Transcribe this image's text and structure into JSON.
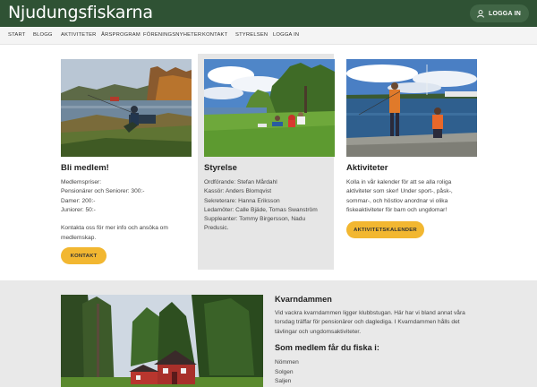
{
  "header": {
    "site_title": "Njudungsfiskarna",
    "login_label": "LOGGA IN"
  },
  "nav": {
    "items": [
      "START",
      "BLOGG",
      "AKTIVITETER",
      "ÅRSPROGRAM",
      "FÖRENINGSNYHETER",
      "KONTAKT",
      "STYRELSEN",
      "LOGGA IN"
    ]
  },
  "cards": [
    {
      "title": "Bli medlem!",
      "lines": [
        "Medlemspriser:",
        "Pensionärer och Seniorer: 300:-",
        "Damer: 200:-",
        "Juniorer: 50:-",
        "",
        "Kontakta oss för mer info och ansöka om",
        "medlemskap."
      ],
      "button": "KONTAKT"
    },
    {
      "title": "Styrelse",
      "lines": [
        "Ordförande: Stefan Mårdahl",
        "Kassör: Anders Blomqvist",
        "Sekreterare: Hanna Eriksson",
        "Ledamöter: Calle Bjäde, Tomas Swanström",
        "Suppleanter: Tommy Birgersson, Nadu",
        "Predusic."
      ]
    },
    {
      "title": "Aktiviteter",
      "lines": [
        "Kolla in vår kalender för att se alla roliga",
        "aktiviteter som sker! Under sport-, påsk-,",
        "sommar-, och höstlov anordnar vi olika",
        "fiskeaktiviteter för barn och ungdomar!"
      ],
      "button": "AKTIVITETSKALENDER"
    }
  ],
  "kvarndammen": {
    "title": "Kvarndammen",
    "lines": [
      "Vid vackra kvarndammen ligger klubbstugan. Här har vi bland annat våra",
      "torsdag träffar för pensionärer och dagledigа. I Kvarndammen hålls det",
      "tävlingar och ungdomsaktiviteter."
    ],
    "subtitle": "Som medlem får du fiska i:",
    "waters": [
      "Nömmen",
      "Solgen",
      "Saljen"
    ]
  },
  "colors": {
    "header_bg": "#2f5234",
    "accent": "#f2b731",
    "section_bg": "#e9e9e9"
  },
  "icons": {
    "login": "user-icon"
  }
}
